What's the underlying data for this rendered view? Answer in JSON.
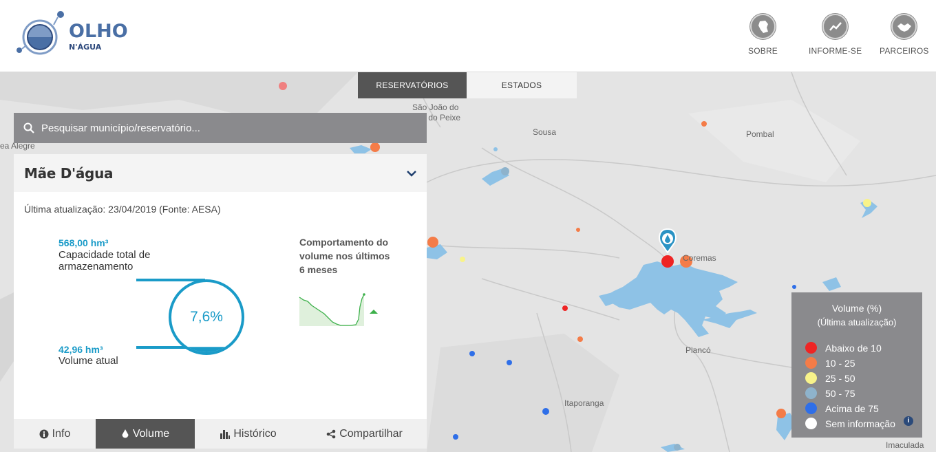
{
  "logo": {
    "line1": "OLHO",
    "line2": "N'ÁGUA"
  },
  "nav": [
    {
      "label": "SOBRE",
      "icon": "map-state-icon"
    },
    {
      "label": "INFORME-SE",
      "icon": "trend-icon"
    },
    {
      "label": "PARCEIROS",
      "icon": "handshake-icon"
    }
  ],
  "top_tabs": [
    {
      "label": "RESERVATÓRIOS",
      "active": true
    },
    {
      "label": "ESTADOS",
      "active": false
    }
  ],
  "search": {
    "placeholder": "Pesquisar município/reservatório..."
  },
  "panel": {
    "title": "Mãe D'água",
    "updated": "Última atualização: 23/04/2019 (Fonte: AESA)",
    "capacity_value": "568,00 hm³",
    "capacity_label": "Capacidade total de armazenamento",
    "current_value": "42,96 hm³",
    "current_label": "Volume atual",
    "percent_text": "7,6%",
    "percent_value": 7.6,
    "trend_title": "Comportamento do volume nos últimos 6 meses",
    "tabs": [
      {
        "label": "Info",
        "icon": "info-icon",
        "active": false
      },
      {
        "label": "Volume",
        "icon": "drop-icon",
        "active": true
      },
      {
        "label": "Histórico",
        "icon": "bar-chart-icon",
        "active": false
      },
      {
        "label": "Compartilhar",
        "icon": "share-icon",
        "active": false
      }
    ]
  },
  "map_labels": [
    "São João do",
    "Rio do Peixe",
    "Sousa",
    "Pombal",
    "Coremas",
    "Piancó",
    "Itaporanga",
    "Imaculada",
    "ea Alegre"
  ],
  "legend": {
    "title": "Volume (%)",
    "subtitle": "(Última atualização)",
    "items": [
      {
        "label": "Abaixo de 10",
        "color": "#ee2424"
      },
      {
        "label": "10 - 25",
        "color": "#f47c48"
      },
      {
        "label": "25 - 50",
        "color": "#f8f38a"
      },
      {
        "label": "50 - 75",
        "color": "#8eb3cc"
      },
      {
        "label": "Acima de 75",
        "color": "#2f6fe8"
      },
      {
        "label": "Sem informação",
        "color": "#ffffff"
      }
    ]
  },
  "colors": {
    "accent": "#1a9bc8",
    "water": "#8ec2e6",
    "panel_dark": "#555555"
  }
}
